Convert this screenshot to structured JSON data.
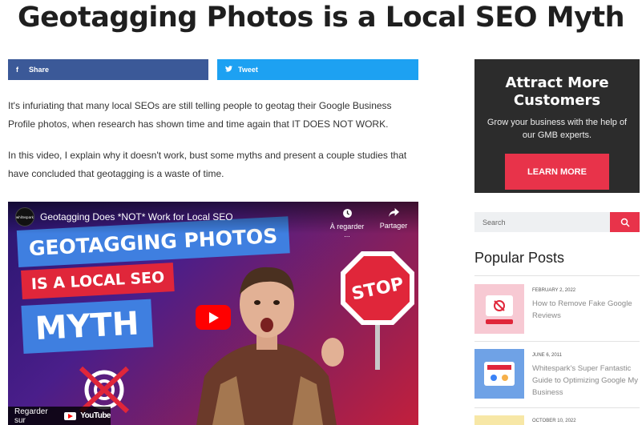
{
  "page": {
    "title": "Geotagging Photos is a Local SEO Myth"
  },
  "social": {
    "share_label": "Share",
    "tweet_label": "Tweet",
    "share_icon": "facebook-icon",
    "tweet_icon": "twitter-icon"
  },
  "article": {
    "paragraphs": [
      "It's infuriating that many local SEOs are still telling people to geotag their Google Business Profile photos, when research has shown time and time again that IT DOES NOT WORK.",
      "In this video, I explain why it doesn't work, bust some myths and present a couple studies that have concluded that geotagging is a waste of time."
    ]
  },
  "video": {
    "title": "Geotagging Does *NOT* Work for Local SEO",
    "channel": "whitespark",
    "watch_later": "À regarder ...",
    "share": "Partager",
    "watch_on": "Regarder sur",
    "youtube": "YouTube",
    "thumbnail_lines": [
      "GEOTAGGING PHOTOS",
      "IS A LOCAL SEO",
      "MYTH"
    ],
    "stop_text": "STOP"
  },
  "sidebar": {
    "ad": {
      "title": "Attract More Customers",
      "text": "Grow your business with the help of our GMB experts.",
      "button": "LEARN MORE"
    },
    "search": {
      "placeholder": "Search"
    },
    "popular_heading": "Popular Posts",
    "posts": [
      {
        "date": "FEBRUARY 2, 2022",
        "title": "How to Remove Fake Google Reviews"
      },
      {
        "date": "JUNE 6, 2011",
        "title": "Whitespark's Super Fantastic Guide to Optimizing Google My Business"
      },
      {
        "date": "OCTOBER 10, 2022",
        "title": ""
      }
    ]
  },
  "colors": {
    "facebook": "#3b5998",
    "twitter": "#1da1f2",
    "accent": "#e8334a",
    "ad_bg": "#2c2c2c"
  }
}
